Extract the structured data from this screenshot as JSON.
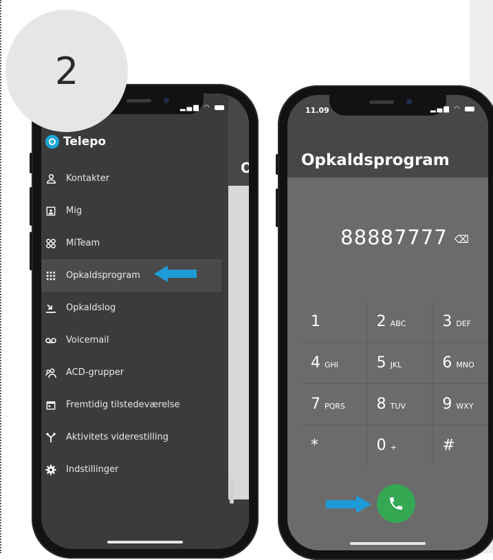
{
  "step": {
    "number": "2"
  },
  "colors": {
    "accent_arrow": "#1e9bd7",
    "call_green": "#34a853",
    "header": "#474747",
    "drawer_bg": "#3b3b3b",
    "dialer_bg": "#6b6b6b"
  },
  "left_phone": {
    "logo_text": "Telepo",
    "behind_title": "O",
    "menu": [
      {
        "label": "Kontakter",
        "icon": "person-icon"
      },
      {
        "label": "Mig",
        "icon": "id-card-icon"
      },
      {
        "label": "MiTeam",
        "icon": "team-icon"
      },
      {
        "label": "Opkaldsprogram",
        "icon": "keypad-icon"
      },
      {
        "label": "Opkaldslog",
        "icon": "call-log-icon"
      },
      {
        "label": "Voicemail",
        "icon": "voicemail-icon"
      },
      {
        "label": "ACD-grupper",
        "icon": "group-icon"
      },
      {
        "label": "Fremtidig tilstedeværelse",
        "icon": "calendar-icon"
      },
      {
        "label": "Aktivitets viderestilling",
        "icon": "forward-icon"
      },
      {
        "label": "Indstillinger",
        "icon": "gear-icon"
      }
    ]
  },
  "right_phone": {
    "time": "11.09",
    "title": "Opkaldsprogram",
    "number": "88887777",
    "keys": [
      [
        {
          "d": "1",
          "l": ""
        },
        {
          "d": "2",
          "l": "ABC"
        },
        {
          "d": "3",
          "l": "DEF"
        }
      ],
      [
        {
          "d": "4",
          "l": "GHI"
        },
        {
          "d": "5",
          "l": "JKL"
        },
        {
          "d": "6",
          "l": "MNO"
        }
      ],
      [
        {
          "d": "7",
          "l": "PQRS"
        },
        {
          "d": "8",
          "l": "TUV"
        },
        {
          "d": "9",
          "l": "WXY"
        }
      ],
      [
        {
          "d": "*",
          "l": ""
        },
        {
          "d": "0",
          "l": "+"
        },
        {
          "d": "#",
          "l": ""
        }
      ]
    ]
  }
}
